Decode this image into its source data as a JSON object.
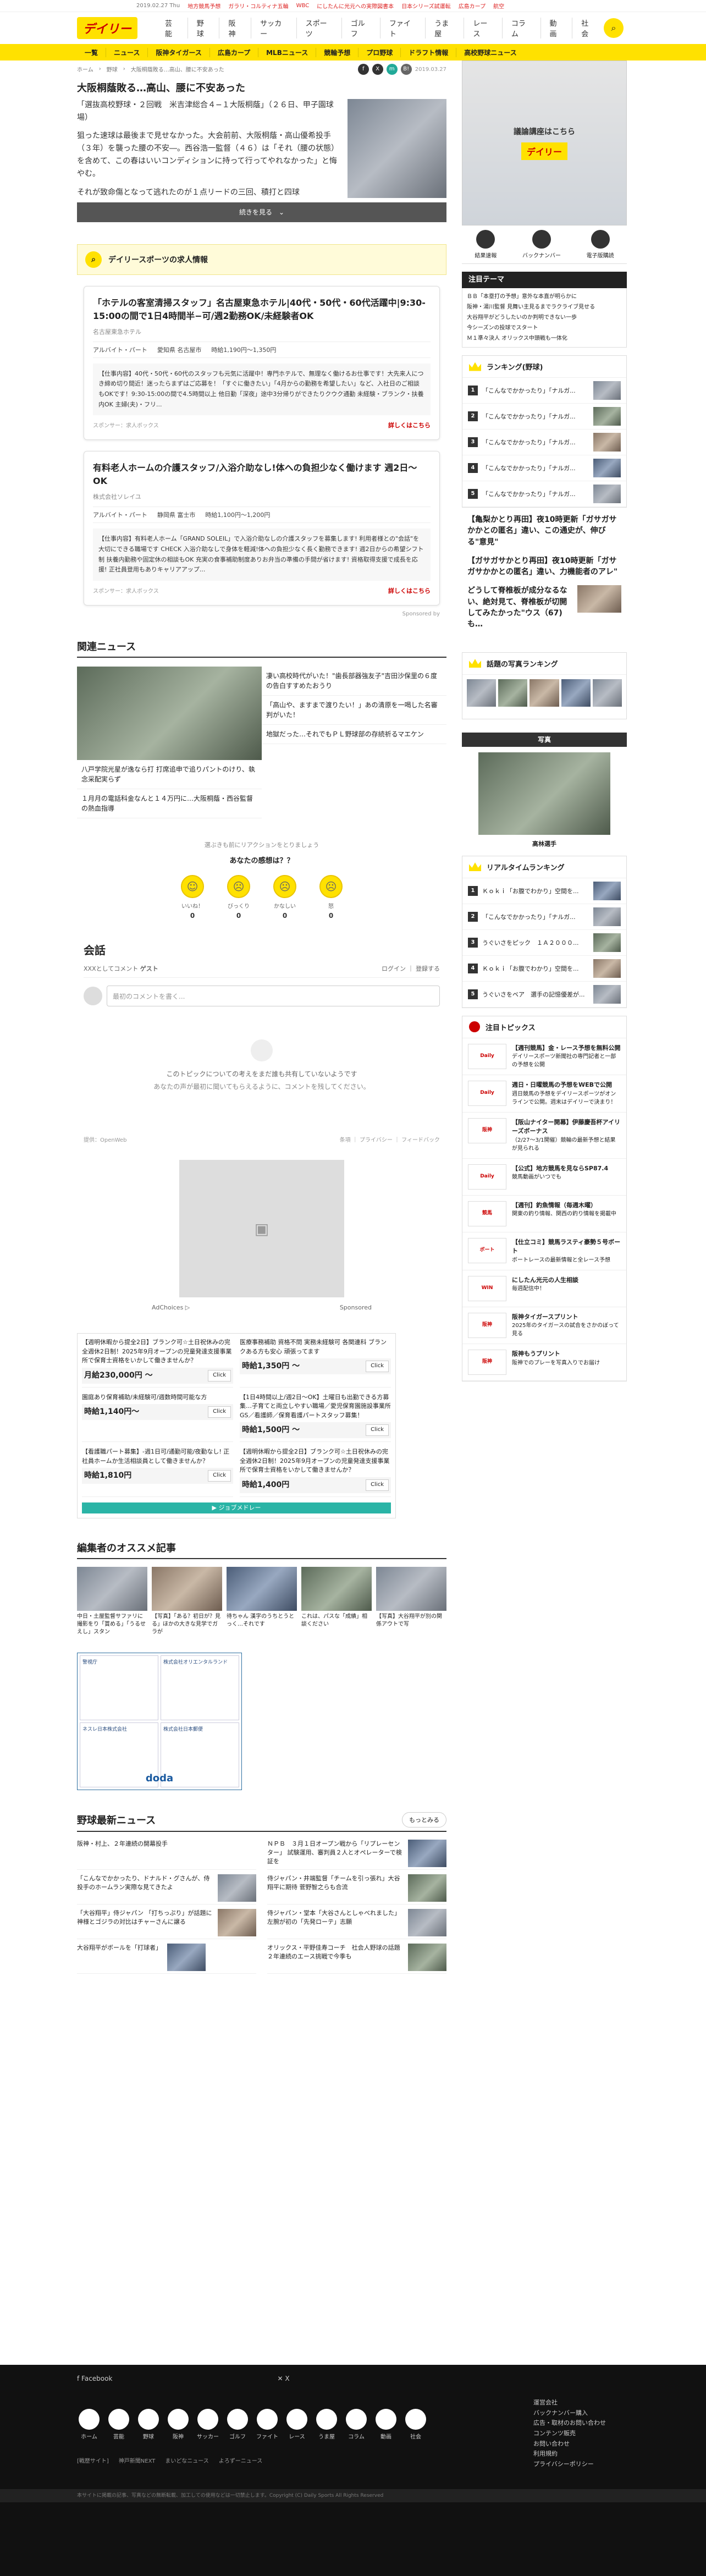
{
  "topbar": {
    "date": "2019.02.27 Thu",
    "links": [
      "地方競馬予想",
      "ガラリ・コルティナ五輪",
      "WBC",
      "にしたんに光元への実際図書本",
      "日本シリーズ試運転",
      "広島カープ",
      "航空"
    ]
  },
  "header": {
    "logo": "デイリー",
    "nav": [
      "芸能",
      "野球",
      "阪神",
      "サッカー",
      "スポーツ",
      "ゴルフ",
      "ファイト",
      "うま屋",
      "レース",
      "コラム",
      "動画",
      "社会"
    ]
  },
  "subnav": [
    "一覧",
    "ニュース",
    "阪神タイガース",
    "広島カープ",
    "MLBニュース",
    "競輪予想",
    "プロ野球",
    "ドラフト情報",
    "高校野球ニュース"
  ],
  "article": {
    "crumbs": [
      "ホーム",
      "野球",
      "大阪桐蔭敗る…高山、腰に不安あった"
    ],
    "share_date": "2019.03.27",
    "title": "大阪桐蔭敗る…高山、腰に不安あった",
    "lead1": "「選抜高校野球・２回戦　米吉津総合４−１大阪桐蔭」（２６日、甲子園球場）",
    "lead2": "狙った速球は最後まで見せなかった。大会前前、大阪桐蔭・高山優希投手（３年）を襲った腰の不安―。西谷浩一監督（４６）は「それ（腰の状態）を含めて、この春はいいコンディションに持って行ってやれなかった」と悔やむ。",
    "lead3": "それが致命傷となって逃れたのが１点リードの三回、積打と四球",
    "more": "続きを見る　⌄"
  },
  "jobs": {
    "head": "デイリースポーツの求人情報",
    "cards": [
      {
        "title": "「ホテルの客室清掃スタッフ」名古屋東急ホテル|40代・50代・60代活躍中|9:30-15:00の間で1日4時間半−可/週2勤務OK/未経験者OK",
        "company": "名古屋東急ホテル",
        "type": "アルバイト・パート",
        "place": "愛知県 名古屋市",
        "wage": "時給1,190円〜1,350円",
        "desc": "【仕事内容】40代・50代・60代のスタッフも元気に活躍中！専門ホテルで、無理なく働けるお仕事です！大先来人につき締め切り間近！迷ったらまずはご応募を！「すぐに働きたい」「4月からの勤務を希望したい」など、入社日のご相談もOKです！9:30-15:00の間で4.5時間以上 他日勤「深夜」途中3分帰りができたりクウク通勤 未経験・ブランク・扶養内OK 主婦(夫)・フリ...",
        "sponsor": "スポンサー：求人ボックス",
        "btn": "詳しくはこちら"
      },
      {
        "title": "有料老人ホームの介護スタッフ/入浴介助なし!体への負担少なく働けます 週2日〜OK",
        "company": "株式会社ソレイユ",
        "type": "アルバイト・パート",
        "place": "静岡県 富士市",
        "wage": "時給1,100円〜1,200円",
        "desc": "【仕事内容】有料老人ホーム「GRAND SOLEIL」で入浴介助なしの介護スタッフを募集します! 利用者様との\"会話\"を大切にできる職場です CHECK 入浴介助なしで身体を軽減!体への負担少なく長く勤務できます! 週2日からの希望シフト制 扶養内勤務や固定休の相談もOK 充実の食事補助制度ありお弁当の準備の手間が省けます! 資格取得支援で成長を応援! 正社員登用もありキャリアアップ...",
        "sponsor": "スポンサー：求人ボックス",
        "btn": "詳しくはこちら"
      }
    ],
    "sponsored": "Sponsored by"
  },
  "related": {
    "head": "関連ニュース",
    "items": [
      "八戸学院光星が逸なら打 打席追申で追りパントのけり、執念采配実らず",
      "１月月の電話科金なんと１４万円に…大阪桐蔭・西谷監督の熱血指導",
      "凄い高校時代がいた！\"歯長部器強友子\"吉田沙保里の６度の告白すすめたおうり",
      "「高山や、ますまで渡りたい！」あの清原を一喝した名審判がいた！",
      "地獄だった…それでもＰＬ野球部の存続祈るマエケン"
    ]
  },
  "reaction": {
    "question": "選ぶきも前にリアクションをとりましょう",
    "heading": "あなたの感想は？？",
    "emotes": [
      {
        "label": "いいね！",
        "count": "0"
      },
      {
        "label": "びっくり",
        "count": "0"
      },
      {
        "label": "かなしい",
        "count": "0"
      },
      {
        "label": "怒",
        "count": "0"
      }
    ]
  },
  "convo": {
    "title": "会話",
    "as": "XXXとしてコメント",
    "guest": "ゲスト",
    "login": "ログイン",
    "signup": "登録する",
    "placeholder": "最初のコメントを書く...",
    "empty1": "このトピックについての考えをまだ誰も共有していないようです",
    "empty2": "あなたの声が最初に聞いてもらえるように、コメントを残してください。",
    "powered": "提供：",
    "openweb": "OpenWeb",
    "footlinks": "条項 ｜ プライバシー ｜ フィードバック"
  },
  "ad": {
    "choices": "AdChoices ▷",
    "sponsored": "Sponsored"
  },
  "jobgrid": {
    "items": [
      {
        "text": "【週明休暇から提全2日】ブランク可☆土日祝休みの完全週休2日制！2025年9月オープンの児童発達支援事業所で保育士資格をいかして働きませんか？",
        "price": "月給230,000円 〜"
      },
      {
        "text": "医療事務補助 資格不問 実務未経験可 各関連科 ブランクある方も安心 頑張ってます",
        "price": "時給1,350円 〜"
      },
      {
        "text": "園庭あり保育補助/未経験可/週数時間可能な方",
        "price": "時給1,140円〜"
      },
      {
        "text": "【1日4時間以上/週2日〜OK】土曜日も出勤できる方募集…子育てと両立しやすい職場／愛児保育園施設事業所 GS／看護師／保育看護パートスタッフ募集！",
        "price": "時給1,500円 〜"
      },
      {
        "text": "【看護職パート募集】-週1日可/通勤可能/夜勤なし! 正社員ホームか生活相談員として働きませんか？",
        "price": "時給1,810円"
      },
      {
        "text": "【週明休暇から提全2日】ブランク可☆土日祝休みの完全週休2日制！2025年9月オープンの児童発達支援事業所で保育士資格をいかして働きませんか？",
        "price": "時給1,400円"
      }
    ],
    "click": "Click",
    "foot": "▶ ジョブメドレー"
  },
  "editor": {
    "head": "編集者のオススメ記事",
    "items": [
      "中日・土屋監督サファリに撮影をり「賞める」「うるせえし」スタン",
      "【写真】「ある？初日が？見る」ほかの大きな見学でガラが",
      "待ちゃん 漢字のうちとうとっく…それです",
      "これは、パスな「成績」相談ください",
      "【写真】大谷翔平が別の関係アウトで写"
    ]
  },
  "doda": {
    "cells": [
      "警視庁",
      "株式会社オリエンタルランド",
      "ネスレ日本株式会社",
      "株式会社日本郵便"
    ],
    "logo": "doda"
  },
  "bnews": {
    "head": "野球最新ニュース",
    "more": "もっとみる",
    "items": [
      "阪神・村上、２年連続の開幕投手",
      "ＮＰＢ　３月１日オープン戦から「リプレーセンター」 試験運用、審判員２人とオペレーターで検証を",
      "「こんなでかかったり、ドナルド・グさんが、侍投手のホームラン実際な見てきたよ",
      "侍ジャパン・井端監督「チームを引っ張れ」大谷翔平に期待 菅野智之らも合流",
      "「大谷翔平」侍ジャパン 「打ちっぷり」が話題に 神様とゴジラの対比はチャーさんに譲る",
      "侍ジャパン・堂本「大谷さんとしゃべれました」左腕が初の「先発ローテ」志願",
      "大谷翔平がボールを「打球者」",
      "オリックス・平野佳寿コーチ　社会人野球の話題 ２年連続のエース挑戦で今季も"
    ]
  },
  "sidebar": {
    "promo": "議論講座はこちら",
    "promobrand": "デイリー",
    "promoicons": [
      "結果速報",
      "バックナンバー",
      "電子版購読"
    ],
    "featured_head": "注目テーマ",
    "featured": [
      "ＢＢ「本塁打の予想」意外な本直が明らかに",
      "阪神・湯川監督 見舞い主見るまでラクライブ見せる",
      "大谷翔平がどうしたいのか判明できない一歩",
      "今シーズンの投球でスタート",
      "Ｍ１準々決人 オリックス中頭戦も一体化"
    ],
    "rank_head": "ランキング(野球)",
    "ranks": [
      {
        "n": "1",
        "t": "「こんなでかかったり」「ナルガ..."
      },
      {
        "n": "2",
        "t": "「こんなでかかったり」「ナルガ..."
      },
      {
        "n": "3",
        "t": "「こんなでかかったり」「ナルガ..."
      },
      {
        "n": "4",
        "t": "「こんなでかかったり」「ナルガ..."
      },
      {
        "n": "5",
        "t": "「こんなでかかったり」「ナルガ..."
      }
    ],
    "heads": [
      "【亀梨かとり再田】夜10時更新「ガサガサかかとの匿名」違い、この通史が、伸びる\"意見\"",
      "【ガサガサかとり再田】夜10時更新「ガサガサかかとの匿名」違い、力機能者のアレ\"",
      "どうして脊椎板が成分なるない、絶対見て、脊椎板が切開してみたかった\"ウス（67)も…"
    ],
    "photo_rank_head": "話題の写真ランキング",
    "photo_head": "写真",
    "photo_cap": "高林選手",
    "realtime_head": "リアルタイムランキング",
    "realtime": [
      {
        "n": "1",
        "t": "Ｋｏｋｉ「お腹でわかり」空間を..."
      },
      {
        "n": "2",
        "t": "「こんなでかかったり」「ナルガ..."
      },
      {
        "n": "3",
        "t": "うぐいさをピック　１Ａ２０００..."
      },
      {
        "n": "4",
        "t": "Ｋｏｋｉ「お腹でわかり」空間を..."
      },
      {
        "n": "5",
        "t": "うぐいさをベア　選手の記憶優差が..."
      }
    ],
    "topics_head": "注目トピックス",
    "topics": [
      {
        "tag": "Daily",
        "t": "【週刊競馬】金・レース予想を無料公開",
        "d": "デイリースポーツ新聞社の専門記者と一部の予想を公開"
      },
      {
        "tag": "Daily",
        "t": "週日・日曜競馬の予想をWEBで公開",
        "d": "週日競馬の予想をデイリースポーツがオンラインで公開。週末はデイリーで決まり！"
      },
      {
        "tag": "阪神",
        "t": "【阪山ナイター開幕】伊藤慶吾杯アイリーズボーナス",
        "d": "（2/27〜3/1開催）競輪の最新予想と結果が見られる"
      },
      {
        "tag": "Daily",
        "t": "【公式】地方競馬を見ならSP87.4",
        "d": "競馬動画がいつでも"
      },
      {
        "tag": "競馬",
        "t": "【週刊】釣魚情報（毎週木曜）",
        "d": "関東の釣り情報、関西の釣り情報を掲載中"
      },
      {
        "tag": "ボート",
        "t": "【仕立コミ】競馬ラスティ豪勢５号ボート",
        "d": "ボートレースの最新情報と全レース予想"
      },
      {
        "tag": "WIN",
        "t": "にしたん光元の人生相談",
        "d": "毎週配信中！"
      },
      {
        "tag": "阪神",
        "t": "阪神タイガースプリント",
        "d": "2025年のタイガースの試合をさかのぼって見る"
      },
      {
        "tag": "阪神",
        "t": "阪神もうプリント",
        "d": "阪神でのプレーを写真入りでお届け"
      }
    ]
  },
  "footer": {
    "facebook": "Facebook",
    "x": "X",
    "icons": [
      "ホーム",
      "芸能",
      "野球",
      "阪神",
      "サッカー",
      "ゴルフ",
      "ファイト",
      "レース",
      "うま屋",
      "コラム",
      "動画",
      "社会"
    ],
    "links": [
      "運営会社",
      "バックナンバー購入",
      "広告・取材のお問い合わせ",
      "コンテンツ販売",
      "お問い合わせ",
      "利用規約",
      "プライバシーポリシー"
    ],
    "bottom": [
      "[戦歴サイト]",
      "神戸新聞NEXT",
      "まいどなニュース",
      "よろずーニュース"
    ],
    "copy": "本サイトに掲載の記事、写真などの無断転載、加工しての使用などは一切禁止します。Copyright (C) Daily Sports All Rights Reserved"
  }
}
